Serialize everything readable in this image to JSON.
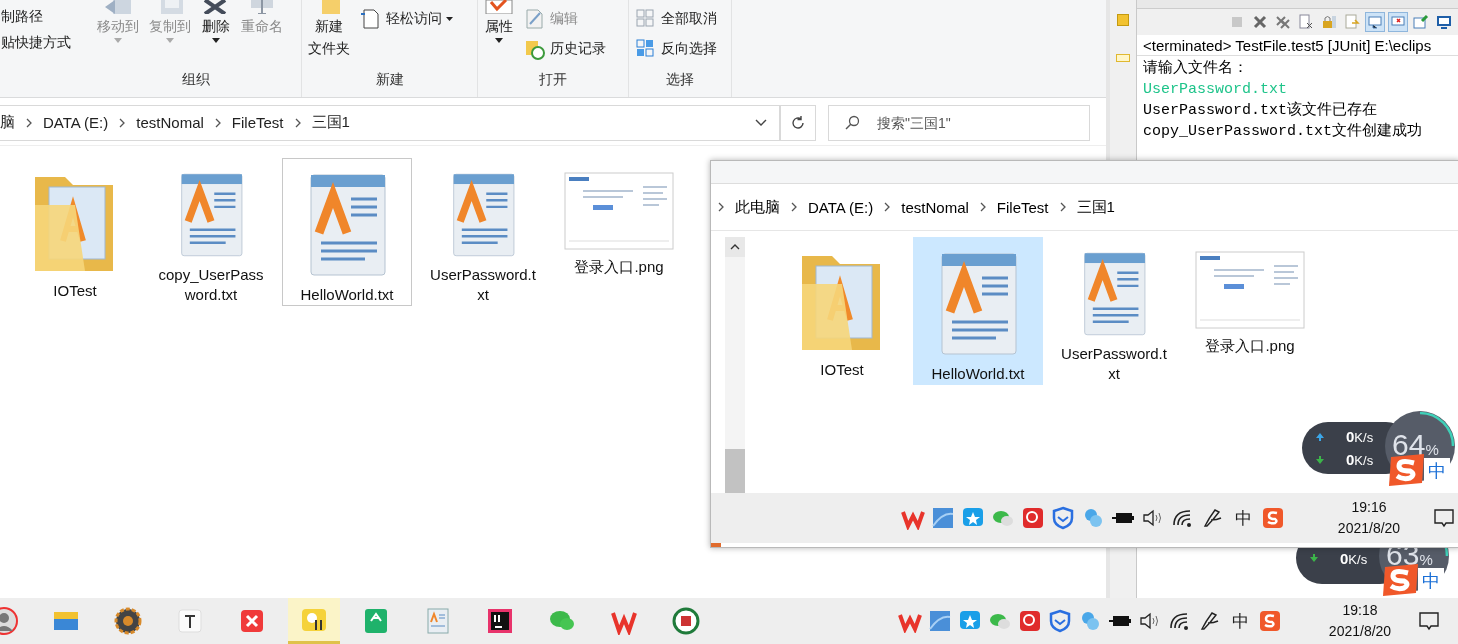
{
  "explorer": {
    "ribbon": {
      "clipboard_items": [
        "制路径",
        "贴快捷方式"
      ],
      "groups": [
        {
          "label": "组织",
          "buttons": [
            {
              "lines": [
                "移动到"
              ],
              "kind": "move",
              "disabled": true,
              "dropdown": true
            },
            {
              "lines": [
                "复制到"
              ],
              "kind": "copy",
              "disabled": true,
              "dropdown": true
            },
            {
              "lines": [
                "删除"
              ],
              "kind": "delete",
              "disabled": false,
              "dropdown": true
            },
            {
              "lines": [
                "重命名"
              ],
              "kind": "rename",
              "disabled": true,
              "dropdown": false
            }
          ]
        },
        {
          "label": "新建",
          "buttons": [
            {
              "lines": [
                "新建",
                "文件夹"
              ],
              "kind": "newfolder",
              "disabled": false,
              "dropdown": false
            },
            {
              "lines": [
                "轻松访问"
              ],
              "kind": "easy",
              "disabled": false,
              "dropdown": true
            }
          ]
        },
        {
          "label": "打开",
          "buttons": [
            {
              "lines": [
                "属性"
              ],
              "kind": "props",
              "disabled": false,
              "dropdown": true
            },
            {
              "lines": [
                "编辑"
              ],
              "kind": "edit",
              "disabled": true,
              "dropdown": false
            },
            {
              "lines": [
                "历史记录"
              ],
              "kind": "history",
              "disabled": false,
              "dropdown": false
            }
          ]
        },
        {
          "label": "选择",
          "buttons": [
            {
              "lines": [
                "全部取消"
              ],
              "kind": "selnone",
              "disabled": false,
              "dropdown": false
            },
            {
              "lines": [
                "反向选择"
              ],
              "kind": "invert",
              "disabled": false,
              "dropdown": false
            }
          ]
        }
      ]
    },
    "path": [
      "脑",
      "DATA (E:)",
      "testNomal",
      "FileTest",
      "三国1"
    ],
    "search": {
      "placeholder": "搜索\"三国1\""
    },
    "files": [
      {
        "name": "IOTest",
        "kind": "folder",
        "focused": false
      },
      {
        "name": "copy_UserPassword.txt",
        "kind": "text",
        "focused": false
      },
      {
        "name": "HelloWorld.txt",
        "kind": "text",
        "focused": true
      },
      {
        "name": "UserPassword.txt",
        "kind": "text",
        "focused": false
      },
      {
        "name": "登录入口.png",
        "kind": "image",
        "focused": false
      }
    ]
  },
  "console": {
    "status": "<terminated> TestFile.test5 [JUnit] E:\\eclips",
    "toolbar": [
      {
        "disabled": true,
        "pressed": false
      },
      {
        "disabled": false,
        "pressed": false
      },
      {
        "disabled": false,
        "pressed": false
      },
      {
        "disabled": false,
        "pressed": false
      },
      {
        "disabled": false,
        "pressed": false
      },
      {
        "disabled": false,
        "pressed": false
      },
      {
        "disabled": false,
        "pressed": true
      },
      {
        "disabled": false,
        "pressed": true
      },
      {
        "disabled": false,
        "pressed": false
      },
      {
        "disabled": false,
        "pressed": false
      }
    ],
    "lines": [
      {
        "text": "请输入文件名：",
        "kind": "output"
      },
      {
        "text": "UserPassword.txt",
        "kind": "input"
      },
      {
        "text": "UserPassword.txt该文件已存在",
        "kind": "output"
      },
      {
        "text": "copy_UserPassword.txt文件创建成功",
        "kind": "output"
      }
    ]
  },
  "inner_window": {
    "path": [
      "此电脑",
      "DATA (E:)",
      "testNomal",
      "FileTest",
      "三国1"
    ],
    "files": [
      {
        "name": "IOTest",
        "kind": "folder",
        "selected": false
      },
      {
        "name": "HelloWorld.txt",
        "kind": "text",
        "selected": true
      },
      {
        "name": "UserPassword.txt",
        "kind": "text",
        "selected": false
      },
      {
        "name": "登录入口.png",
        "kind": "image",
        "selected": false
      }
    ],
    "taskbar": {
      "ime_label": "中",
      "time": "19:16",
      "date": "2021/8/20"
    }
  },
  "net_widgets": [
    {
      "upload": "**0**K/s",
      "download": "**0**K/s",
      "percent": "64",
      "unit": "%",
      "ime_label": "中"
    },
    {
      "download": "**0**K/s",
      "percent": "63",
      "unit": "%",
      "ime_label": "中"
    }
  ],
  "taskbar": {
    "apps": [
      {
        "active": false
      },
      {
        "active": false
      },
      {
        "active": false
      },
      {
        "active": false
      },
      {
        "active": false
      },
      {
        "active": true
      },
      {
        "active": false
      },
      {
        "active": false
      },
      {
        "active": false
      },
      {
        "active": false
      },
      {
        "active": false
      },
      {
        "active": false
      }
    ],
    "ime_label": "中",
    "time": "19:18",
    "date": "2021/8/20"
  }
}
